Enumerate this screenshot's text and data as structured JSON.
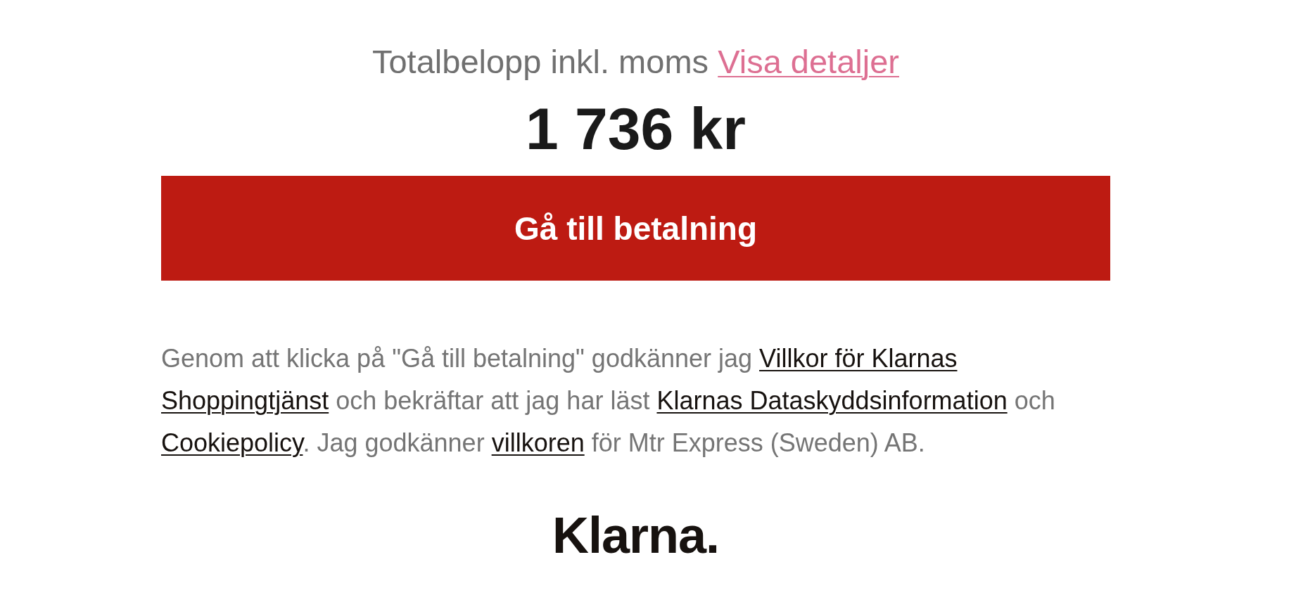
{
  "summary": {
    "label": "Totalbelopp inkl. moms",
    "details_link": "Visa detaljer",
    "amount": "1 736 kr"
  },
  "pay_button": {
    "label": "Gå till betalning"
  },
  "terms": [
    {
      "kind": "text",
      "text": "Genom att klicka på \"Gå till betalning\" godkänner jag "
    },
    {
      "kind": "link",
      "parts": [
        "Villkor för Klarnas",
        "Shoppingtjänst"
      ]
    },
    {
      "kind": "text",
      "text": " och bekräftar att jag har läst "
    },
    {
      "kind": "link",
      "parts": [
        "Klarnas Dataskyddsinformation"
      ]
    },
    {
      "kind": "text",
      "text": " och "
    },
    {
      "kind": "link",
      "parts": [
        "Cookiepolicy"
      ]
    },
    {
      "kind": "text",
      "text": ". Jag godkänner "
    },
    {
      "kind": "link",
      "parts": [
        "villkoren"
      ]
    },
    {
      "kind": "text",
      "text": " för Mtr Express (Sweden) AB."
    }
  ],
  "logo": {
    "text": "Klarna."
  }
}
